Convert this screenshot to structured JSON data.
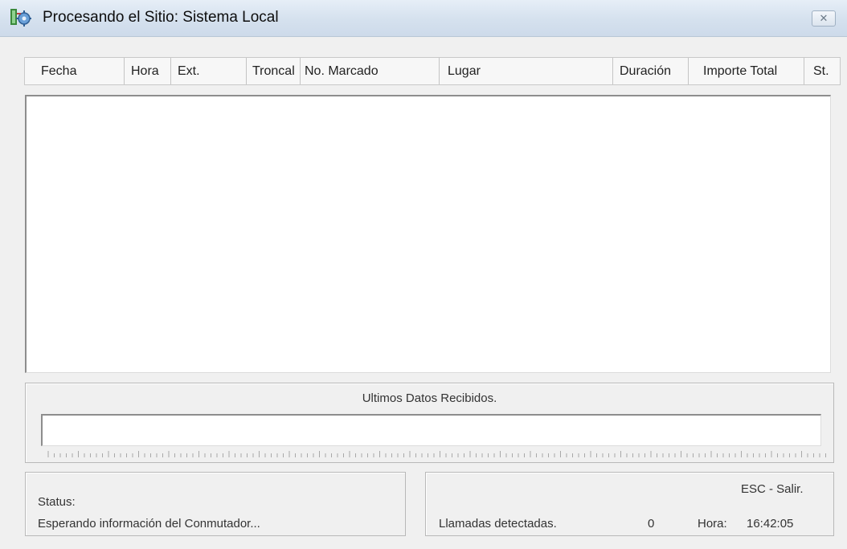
{
  "window": {
    "title": "Procesando el Sitio: Sistema Local",
    "close_glyph": "✕"
  },
  "columns": [
    {
      "label": "Fecha"
    },
    {
      "label": "Hora"
    },
    {
      "label": "Ext."
    },
    {
      "label": "Troncal"
    },
    {
      "label": "No. Marcado"
    },
    {
      "label": "Lugar"
    },
    {
      "label": "Duración"
    },
    {
      "label": "Importe Total"
    },
    {
      "label": "St."
    }
  ],
  "received": {
    "label": "Ultimos Datos Recibidos.",
    "value": ""
  },
  "status": {
    "label": "Status:",
    "message": "Esperando información del Conmutador..."
  },
  "counter": {
    "exit_hint": "ESC - Salir.",
    "calls_label": "Llamadas detectadas.",
    "calls_count": "0",
    "time_label": "Hora:",
    "time_value": "16:42:05"
  },
  "icons": {
    "app": "gear-network-icon",
    "close": "close-icon"
  },
  "colors": {
    "titlebar": "#d5e1ee",
    "window_bg": "#f0f0f0"
  }
}
